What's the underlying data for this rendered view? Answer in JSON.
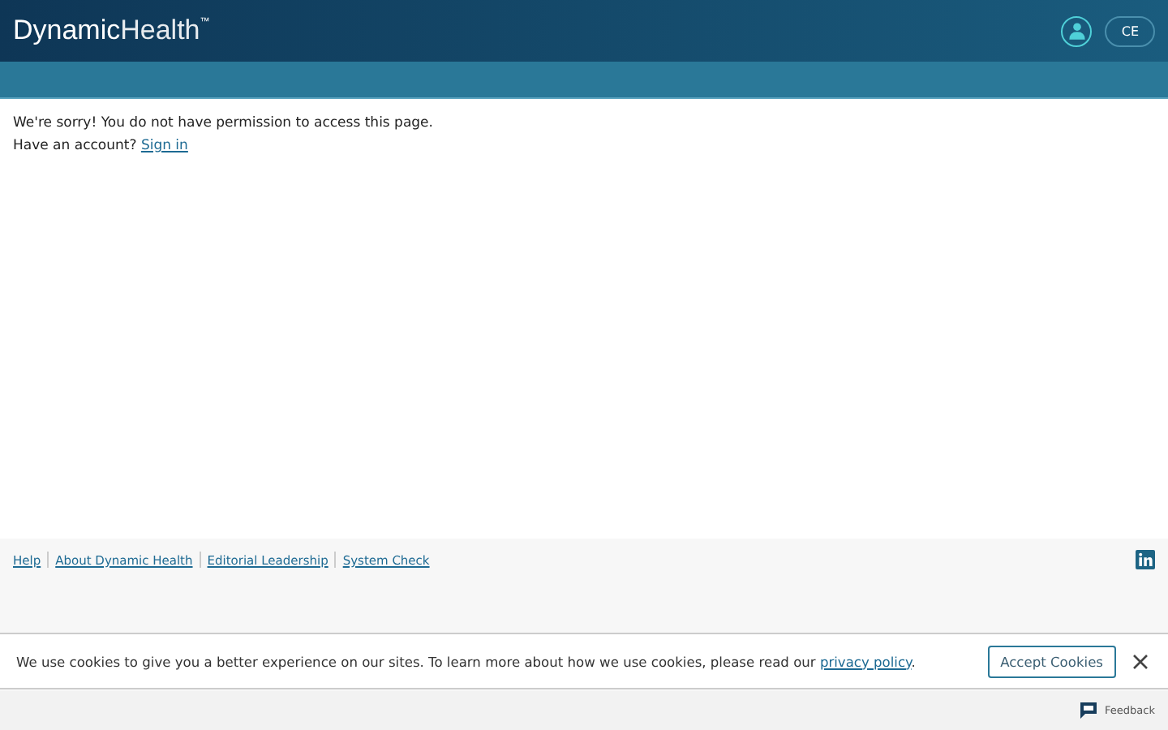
{
  "header": {
    "brand": {
      "name": "Dynamic",
      "suffix": "Health",
      "mark": "™"
    },
    "account_button": {
      "label": "CE"
    }
  },
  "message": {
    "text": "We're sorry! You do not have permission to access this page.",
    "prompt": "Have an account?",
    "link": "Sign in"
  },
  "footer": {
    "links": [
      "Help",
      "About Dynamic Health",
      "Editorial Leadership",
      "System Check"
    ]
  },
  "cookie_banner": {
    "text_before": "We use cookies to give you a better experience on our sites. To learn more about how we use cookies, please read our ",
    "link": "privacy policy",
    "text_after": ".",
    "button": "Accept Cookies"
  },
  "feedback": {
    "label": "Feedback"
  }
}
